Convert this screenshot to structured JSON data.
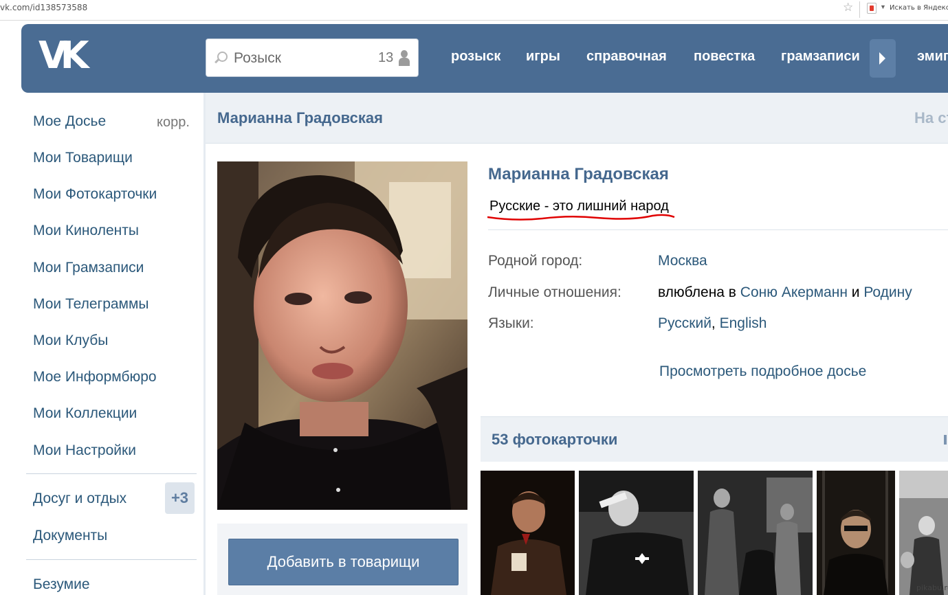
{
  "browser": {
    "url": "vk.com/id138573588",
    "search_placeholder": "Искать в Яндексе"
  },
  "header": {
    "logo_text": "VK",
    "search_placeholder": "Розыск",
    "search_count": "13",
    "nav": [
      "розыск",
      "игры",
      "справочная",
      "повестка",
      "грамзаписи",
      "эмиг"
    ]
  },
  "sidebar": {
    "items": [
      {
        "label": "Мое Досье",
        "extra": "корр."
      },
      {
        "label": "Мои Товарищи"
      },
      {
        "label": "Мои Фотокарточки"
      },
      {
        "label": "Мои Киноленты"
      },
      {
        "label": "Мои Грамзаписи"
      },
      {
        "label": "Мои Телеграммы"
      },
      {
        "label": "Мои Клубы"
      },
      {
        "label": "Мое Информбюро"
      },
      {
        "label": "Мои Коллекции"
      },
      {
        "label": "Мои Настройки"
      }
    ],
    "apps": [
      {
        "label": "Досуг и отдых",
        "badge": "+3"
      },
      {
        "label": "Документы"
      }
    ],
    "extra_items": [
      {
        "label": "Безумие"
      }
    ]
  },
  "page": {
    "title": "Марианна Градовская",
    "right_link": "На ст"
  },
  "profile": {
    "name": "Марианна Градовская",
    "status": "Русские - это лишний народ",
    "info": [
      {
        "label": "Родной город:",
        "value": "Москва"
      },
      {
        "label": "Личные отношения:",
        "value_prefix": "влюблена в ",
        "value_link1": "Соню Акерманн",
        "value_mid": " и ",
        "value_link2": "Родину"
      },
      {
        "label": "Языки:",
        "value_link1": "Русский",
        "value_mid": ", ",
        "value_link2": "English"
      }
    ],
    "more_link": "Просмотреть подробное досье",
    "add_button": "Добавить в товарищи"
  },
  "photos": {
    "title": "53 фотокарточки"
  },
  "watermark": "pikabu.ru",
  "colors": {
    "header_blue": "#4a6c93",
    "link_blue": "#2b587a",
    "title_blue": "#45688e",
    "status_underline": "#e00000"
  }
}
